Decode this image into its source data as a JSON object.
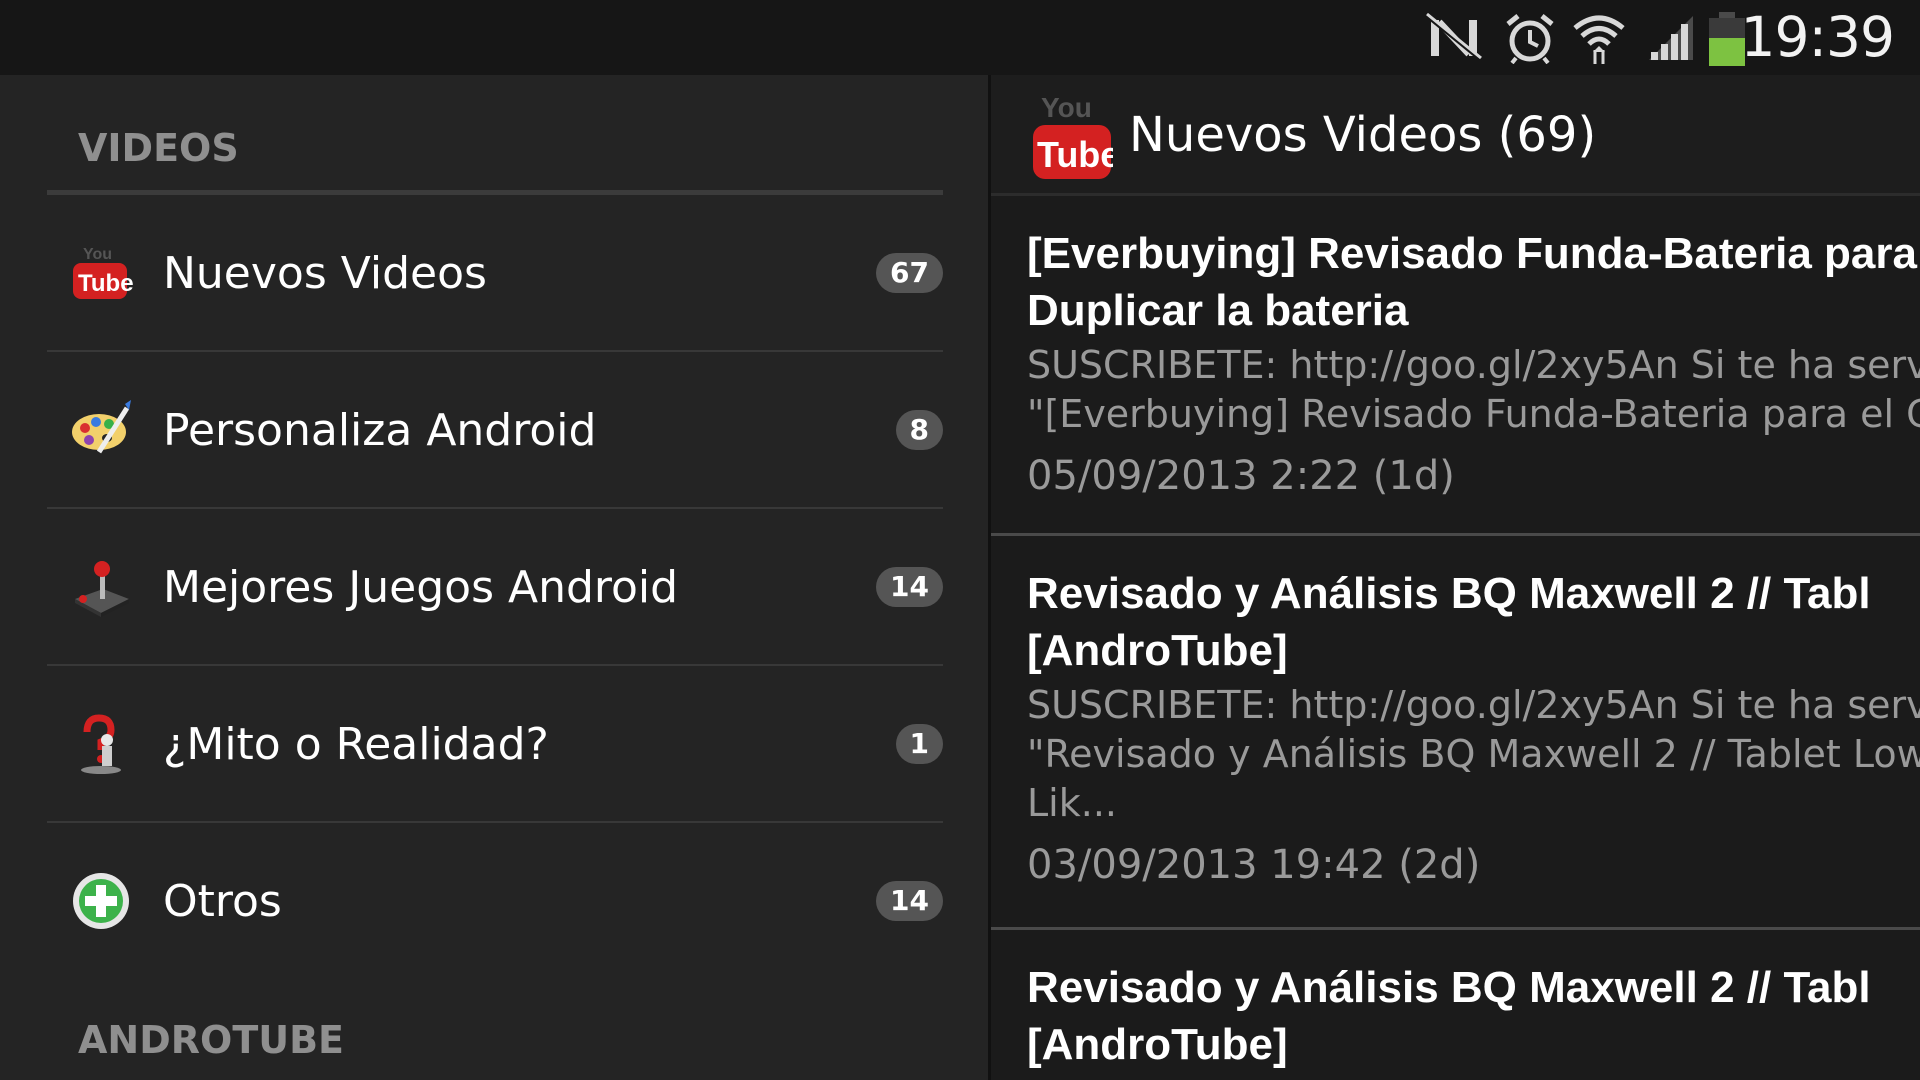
{
  "status_bar": {
    "time": "19:39",
    "icons": [
      "nfc-off-icon",
      "alarm-icon",
      "wifi-icon",
      "signal-icon",
      "battery-icon"
    ],
    "battery_color": "#7dc241"
  },
  "drawer": {
    "section_videos": "VIDEOS",
    "section_androtube": "ANDROTUBE",
    "items": [
      {
        "label": "Nuevos Videos",
        "count": "67",
        "icon": "youtube-icon"
      },
      {
        "label": "Personaliza Android",
        "count": "8",
        "icon": "palette-icon"
      },
      {
        "label": "Mejores Juegos Android",
        "count": "14",
        "icon": "joystick-icon"
      },
      {
        "label": "¿Mito o Realidad?",
        "count": "1",
        "icon": "question-icon"
      },
      {
        "label": "Otros",
        "count": "14",
        "icon": "plus-icon"
      }
    ]
  },
  "content": {
    "title": "Nuevos Videos (69)",
    "icon": "youtube-icon",
    "videos": [
      {
        "title": "[Everbuying] Revisado Funda-Bateria para\nDuplicar la bateria",
        "description": "SUSCRIBETE: http://goo.gl/2xy5An Si te ha serv\n\"[Everbuying] Revisado Funda-Bateria para el Ga",
        "date": "05/09/2013 2:22 (1d)"
      },
      {
        "title": "Revisado y Análisis BQ Maxwell 2 // Tabl\n[AndroTube]",
        "description": "SUSCRIBETE: http://goo.gl/2xy5An Si te ha serv\n\"Revisado y Análisis BQ Maxwell 2 // Tablet Low\nLik...",
        "date": "03/09/2013 19:42 (2d)"
      },
      {
        "title": "Revisado y Análisis BQ Maxwell 2 // Tabl\n[AndroTube]",
        "description": "",
        "date": ""
      }
    ]
  },
  "colors": {
    "background": "#1e1e1e",
    "drawer": "#242424",
    "badge": "#555555",
    "youtube_red": "#d42121"
  }
}
